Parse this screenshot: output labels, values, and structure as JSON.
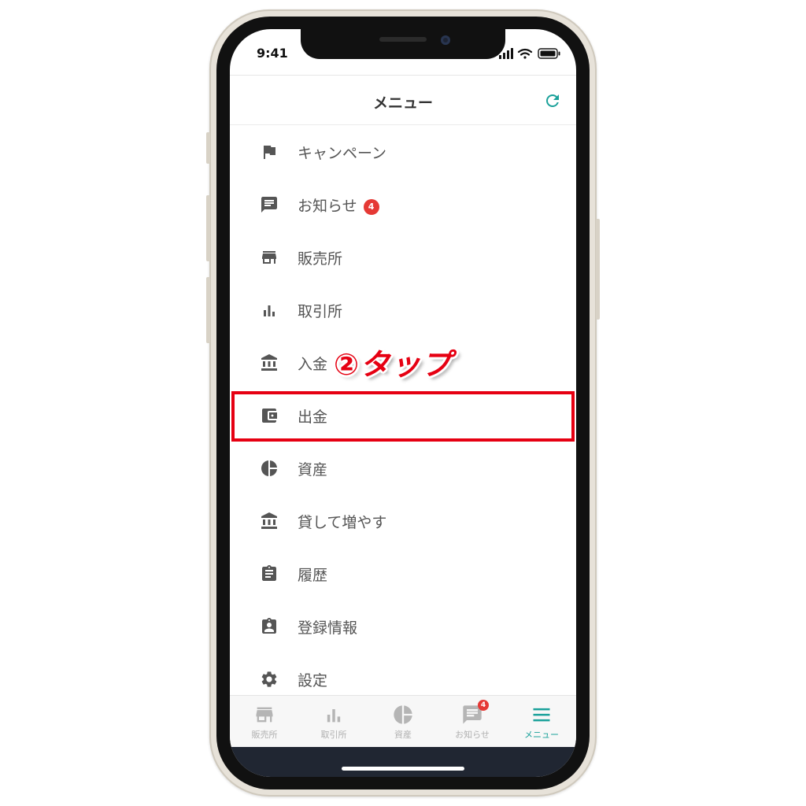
{
  "status_bar": {
    "time": "9:41"
  },
  "header": {
    "title": "メニュー",
    "refresh_icon": "refresh-icon",
    "accent": "#1aa19a"
  },
  "menu": {
    "items": [
      {
        "label": "キャンペーン",
        "icon": "flag-icon"
      },
      {
        "label": "お知らせ",
        "icon": "message-icon",
        "badge": "4"
      },
      {
        "label": "販売所",
        "icon": "store-icon"
      },
      {
        "label": "取引所",
        "icon": "bar-chart-icon"
      },
      {
        "label": "入金",
        "icon": "bank-icon"
      },
      {
        "label": "出金",
        "icon": "wallet-icon"
      },
      {
        "label": "資産",
        "icon": "pie-chart-icon"
      },
      {
        "label": "貸して増やす",
        "icon": "bank-icon"
      },
      {
        "label": "履歴",
        "icon": "clipboard-icon"
      },
      {
        "label": "登録情報",
        "icon": "contact-icon"
      },
      {
        "label": "設定",
        "icon": "gear-icon"
      }
    ]
  },
  "annotation": {
    "text": "②タップ",
    "color": "#e60012"
  },
  "tabbar": {
    "tabs": [
      {
        "label": "販売所",
        "icon": "store-icon"
      },
      {
        "label": "取引所",
        "icon": "bar-chart-icon"
      },
      {
        "label": "資産",
        "icon": "pie-chart-icon"
      },
      {
        "label": "お知らせ",
        "icon": "message-icon",
        "badge": "4"
      },
      {
        "label": "メニュー",
        "icon": "menu-icon",
        "active": true
      }
    ]
  }
}
